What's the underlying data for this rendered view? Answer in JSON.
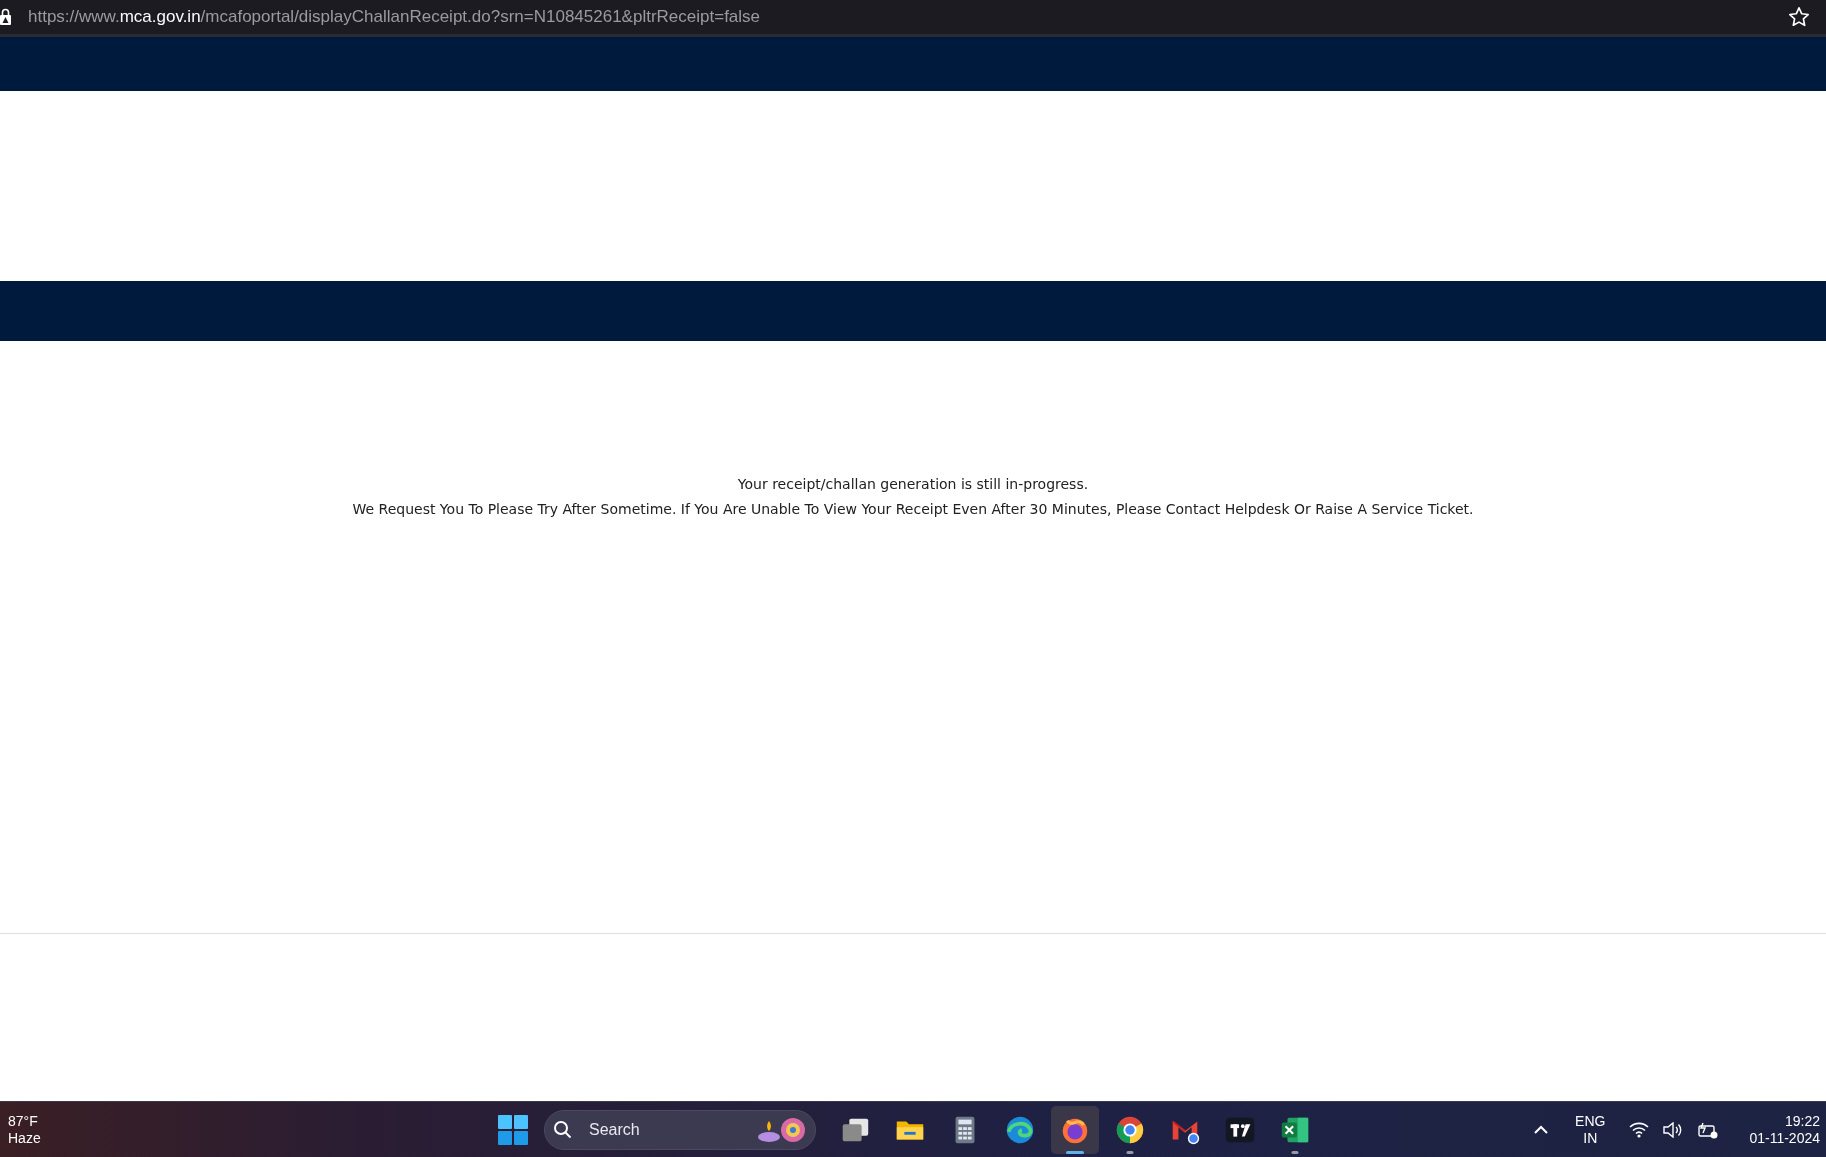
{
  "browser": {
    "url_scheme": "https://www.",
    "url_host": "mca.gov.in",
    "url_path": "/mcafoportal/displayChallanReceipt.do?srn=N10845261&pltrReceipt=false",
    "bookmarked": false
  },
  "message": {
    "status": "Your receipt/challan generation is still in-progress.",
    "request": "We Request You To Please Try After Sometime. If You Are Unable To View Your Receipt Even After 30 Minutes, Please Contact Helpdesk Or Raise A Service Ticket."
  },
  "taskbar": {
    "weather": {
      "temperature": "87°F",
      "condition": "Haze"
    },
    "search": {
      "placeholder": "Search"
    },
    "apps": [
      {
        "kind": "taskview",
        "running": false,
        "active": false
      },
      {
        "kind": "folder",
        "running": false,
        "active": false
      },
      {
        "kind": "calculator",
        "running": false,
        "active": false
      },
      {
        "kind": "edge",
        "running": false,
        "active": false
      },
      {
        "kind": "firefox",
        "running": true,
        "active": true
      },
      {
        "kind": "chrome",
        "running": true,
        "active": false
      },
      {
        "kind": "mail",
        "running": false,
        "active": false
      },
      {
        "kind": "chart",
        "running": false,
        "active": false
      },
      {
        "kind": "excel",
        "running": true,
        "active": false
      }
    ],
    "language": {
      "line1": "ENG",
      "line2": "IN"
    },
    "time": "19:22",
    "date": "01-11-2024"
  }
}
